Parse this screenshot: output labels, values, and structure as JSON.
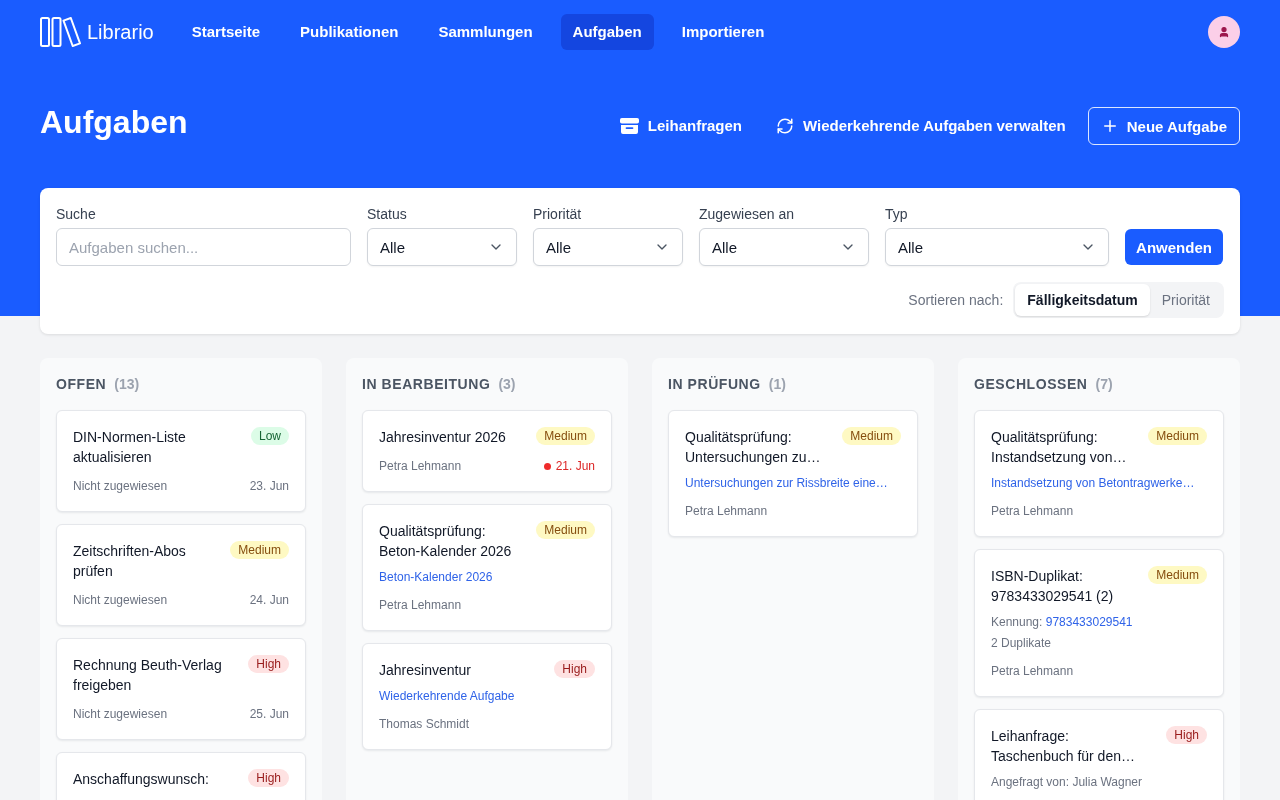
{
  "app": {
    "name": "Librario"
  },
  "nav": [
    {
      "label": "Startseite",
      "selected": false
    },
    {
      "label": "Publikationen",
      "selected": false
    },
    {
      "label": "Sammlungen",
      "selected": false
    },
    {
      "label": "Aufgaben",
      "selected": true
    },
    {
      "label": "Importieren",
      "selected": false
    }
  ],
  "page": {
    "title": "Aufgaben"
  },
  "actions": [
    {
      "kind": "inbox",
      "label": "Leihanfragen"
    },
    {
      "kind": "recurring",
      "label": "Wiederkehrende Aufgaben verwalten"
    },
    {
      "kind": "create",
      "label": "Neue Aufgabe"
    }
  ],
  "filters": {
    "search": {
      "label": "Suche",
      "placeholder": "Aufgaben suchen..."
    },
    "selects": [
      {
        "label": "Status",
        "value": "Alle"
      },
      {
        "label": "Priorität",
        "value": "Alle"
      },
      {
        "label": "Zugewiesen an",
        "value": "Alle"
      },
      {
        "label": "Typ",
        "value": "Alle"
      }
    ],
    "apply_button": "Anwenden",
    "sort": {
      "label": "Sortieren nach:",
      "options": [
        {
          "label": "Fälligkeitsdatum",
          "selected": true
        },
        {
          "label": "Priorität",
          "selected": false
        }
      ]
    }
  },
  "columns": [
    {
      "title": "OFFEN",
      "count": "(13)",
      "cards": [
        {
          "title": "DIN-Normen-Liste aktualisieren",
          "priority": {
            "label": "Low",
            "kind": "low"
          },
          "assignee": "Nicht zugewiesen",
          "due": {
            "text": "23. Jun",
            "overdue": false
          }
        },
        {
          "title": "Zeitschriften-Abos prüfen",
          "priority": {
            "label": "Medium",
            "kind": "medium"
          },
          "assignee": "Nicht zugewiesen",
          "due": {
            "text": "24. Jun",
            "overdue": false
          }
        },
        {
          "title": "Rechnung Beuth-Verlag freigeben",
          "priority": {
            "label": "High",
            "kind": "high"
          },
          "assignee": "Nicht zugewiesen",
          "due": {
            "text": "25. Jun",
            "overdue": false
          }
        },
        {
          "title": "Anschaffungswunsch:",
          "priority": {
            "label": "High",
            "kind": "high"
          }
        }
      ]
    },
    {
      "title": "IN BEARBEITUNG",
      "count": "(3)",
      "cards": [
        {
          "title": "Jahresinventur 2026",
          "priority": {
            "label": "Medium",
            "kind": "medium"
          },
          "assignee": "Petra Lehmann",
          "due": {
            "text": "21. Jun",
            "overdue": true
          }
        },
        {
          "title": "Qualitätsprüfung: Beton-Kalender 2026",
          "priority": {
            "label": "Medium",
            "kind": "medium"
          },
          "details": [
            {
              "kind": "link",
              "text": "Beton-Kalender 2026"
            }
          ],
          "assignee": "Petra Lehmann"
        },
        {
          "title": "Jahresinventur",
          "priority": {
            "label": "High",
            "kind": "high"
          },
          "details": [
            {
              "kind": "link",
              "text": "Wiederkehrende Aufgabe"
            }
          ],
          "assignee": "Thomas Schmidt"
        }
      ]
    },
    {
      "title": "IN PRÜFUNG",
      "count": "(1)",
      "cards": [
        {
          "title": "Qualitätsprüfung: Untersuchungen zu…",
          "priority": {
            "label": "Medium",
            "kind": "medium"
          },
          "details": [
            {
              "kind": "link",
              "text": "Untersuchungen zur Rissbreite eine…"
            }
          ],
          "assignee": "Petra Lehmann"
        }
      ]
    },
    {
      "title": "GESCHLOSSEN",
      "count": "(7)",
      "cards": [
        {
          "title": "Qualitätsprüfung: Instandsetzung von…",
          "priority": {
            "label": "Medium",
            "kind": "medium"
          },
          "details": [
            {
              "kind": "link",
              "text": "Instandsetzung von Betontragwerke…"
            }
          ],
          "assignee": "Petra Lehmann"
        },
        {
          "title": "ISBN-Duplikat: 9783433029541 (2)",
          "priority": {
            "label": "Medium",
            "kind": "medium"
          },
          "details": [
            {
              "kind": "field",
              "label": "Kennung:",
              "value": "9783433029541"
            },
            {
              "kind": "note",
              "text": "2 Duplikate"
            }
          ],
          "assignee": "Petra Lehmann"
        },
        {
          "title": "Leihanfrage: Taschenbuch für den…",
          "priority": {
            "label": "High",
            "kind": "high"
          },
          "details": [
            {
              "kind": "note",
              "text": "Angefragt von: Julia Wagner"
            }
          ]
        }
      ]
    }
  ]
}
